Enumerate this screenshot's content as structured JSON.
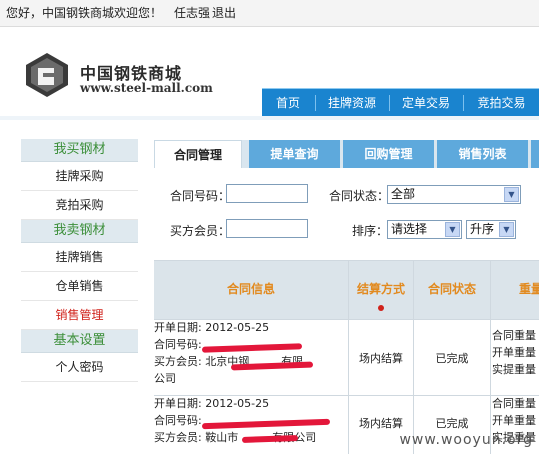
{
  "topbar": {
    "greeting": "您好，中国钢铁商城欢迎您！",
    "user": "任志强",
    "logout": "退出"
  },
  "logo": {
    "name_cn": "中国钢铁商城",
    "url": "www.steel-mall.com",
    "icon": "steel-mall-logo-icon"
  },
  "nav": {
    "items": [
      "首页",
      "挂牌资源",
      "定单交易",
      "竞拍交易"
    ]
  },
  "sidebar": {
    "sections": [
      {
        "title": "我买钢材",
        "items": [
          "挂牌采购",
          "竞拍采购"
        ]
      },
      {
        "title": "我卖钢材",
        "items": [
          "挂牌销售",
          "仓单销售",
          "销售管理"
        ]
      },
      {
        "title": "基本设置",
        "items": [
          "个人密码"
        ]
      }
    ],
    "active_item": "销售管理"
  },
  "tabs": {
    "items": [
      "合同管理",
      "提单查询",
      "回购管理",
      "销售列表"
    ],
    "active": "合同管理"
  },
  "form": {
    "contract_no_label": "合同号码：",
    "contract_no_value": "",
    "status_label": "合同状态：",
    "status_value": "全部",
    "buyer_label": "买方会员：",
    "buyer_value": "",
    "sort_label": "排序：",
    "sort_value": "请选择",
    "order_value": "升序"
  },
  "table": {
    "headers": [
      "合同信息",
      "结算方式",
      "合同状态",
      "重量"
    ],
    "rows": [
      {
        "date": "开单日期: 2012-05-25",
        "contract": "合同号码:",
        "buyer_line1": "买方会员: 北京中",
        "buyer_mid": "钢",
        "buyer_line1_end": "有限",
        "buyer_line2": "公司",
        "settlement": "场内结算",
        "status": "已完成",
        "weights": [
          "合同重量",
          "开单重量",
          "实提重量"
        ]
      },
      {
        "date": "开单日期: 2012-05-25",
        "contract": "合同号码:",
        "buyer_line1": "买方会员: 鞍山市",
        "buyer_line1_end": "有限公司",
        "settlement": "场内结算",
        "status": "已完成",
        "weights": [
          "合同重量",
          "开单重量",
          "实提重量"
        ]
      }
    ]
  },
  "watermark": "www.wooyun.org",
  "colors": {
    "nav_blue": "#1a84cf",
    "tab_blue": "#5ea9dc",
    "sidebar_green": "#3c8f3a",
    "active_red": "#d0221b",
    "header_orange": "#e28a1f"
  }
}
